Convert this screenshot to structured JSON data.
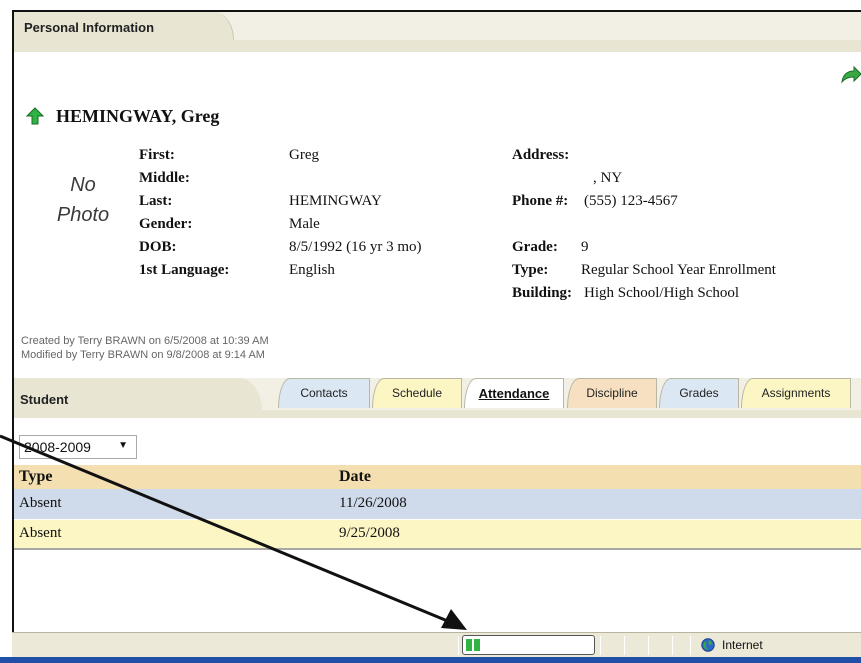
{
  "section": {
    "title": "Personal Information"
  },
  "student": {
    "name": "HEMINGWAY, Greg",
    "photo_placeholder": [
      "No",
      "Photo"
    ],
    "labels": {
      "first": "First:",
      "middle": "Middle:",
      "last": "Last:",
      "gender": "Gender:",
      "dob": "DOB:",
      "language": "1st Language:",
      "address": "Address:",
      "phone": "Phone #:",
      "grade": "Grade:",
      "type": "Type:",
      "building": "Building:"
    },
    "values": {
      "first": "Greg",
      "middle": "",
      "last": "HEMINGWAY",
      "gender": "Male",
      "dob": "8/5/1992 (16 yr 3 mo)",
      "language": "English",
      "address_line": ", NY",
      "phone": "(555) 123-4567",
      "grade": "9",
      "type": "Regular School Year Enrollment",
      "building": "High School/High School"
    }
  },
  "audit": {
    "created": "Created by Terry BRAWN on 6/5/2008 at 10:39 AM",
    "modified": "Modified by Terry BRAWN on 9/8/2008 at 9:14 AM"
  },
  "tabs": {
    "section_label": "Student",
    "items": [
      {
        "label": "Contacts"
      },
      {
        "label": "Schedule"
      },
      {
        "label": "Attendance"
      },
      {
        "label": "Discipline"
      },
      {
        "label": "Grades"
      },
      {
        "label": "Assignments"
      }
    ],
    "active": "Attendance"
  },
  "year_select": {
    "value": "2008-2009"
  },
  "table": {
    "headers": [
      "Type",
      "Date"
    ],
    "rows": [
      [
        "Absent",
        "11/26/2008"
      ],
      [
        "Absent",
        "9/25/2008"
      ]
    ]
  },
  "status_bar": {
    "zone": "Internet",
    "progress_fraction": 0.1
  },
  "icons": {
    "forward": "forward-arrow-icon",
    "up": "up-arrow-icon",
    "globe": "globe-icon"
  },
  "colors": {
    "accent_green": "#2fb343",
    "row_blue": "#cfdbea",
    "row_yellow": "#fbf6c4",
    "header_tan": "#f4dfb0"
  }
}
